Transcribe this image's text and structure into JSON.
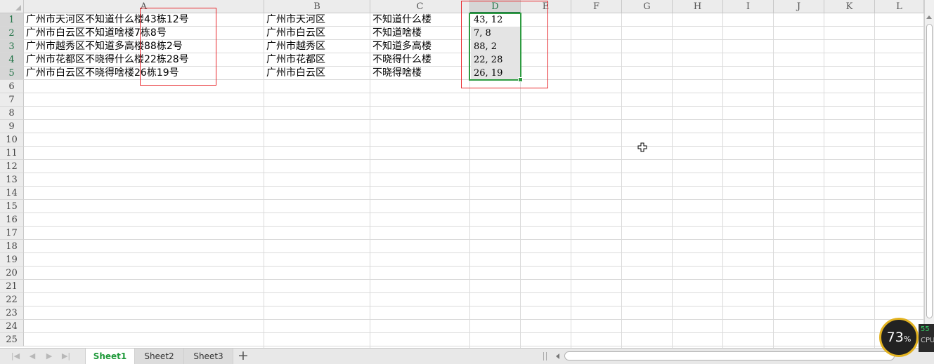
{
  "columns": [
    "A",
    "B",
    "C",
    "D",
    "E",
    "F",
    "G",
    "H",
    "I",
    "J",
    "K",
    "L"
  ],
  "rows": [
    "1",
    "2",
    "3",
    "4",
    "5",
    "6",
    "7",
    "8",
    "9",
    "10",
    "11",
    "12",
    "13",
    "14",
    "15",
    "16",
    "17",
    "18",
    "19",
    "20",
    "21",
    "22",
    "23",
    "24",
    "25"
  ],
  "cells": {
    "A": [
      "广州市天河区不知道什么楼43栋12号",
      "广州市白云区不知道啥楼7栋8号",
      "广州市越秀区不知道多高楼88栋2号",
      "广州市花都区不晓得什么楼22栋28号",
      "广州市白云区不晓得啥楼26栋19号"
    ],
    "B": [
      "广州市天河区",
      "广州市白云区",
      "广州市越秀区",
      "广州市花都区",
      "广州市白云区"
    ],
    "C": [
      "不知道什么楼",
      "不知道啥楼",
      "不知道多高楼",
      "不晓得什么楼",
      "不晓得啥楼"
    ],
    "D": [
      "43, 12",
      "7, 8",
      "88, 2",
      "22, 28",
      "26, 19"
    ]
  },
  "selection": {
    "column": "D",
    "rows": "1-5",
    "active_cell": "D1"
  },
  "sheet_tabs": [
    {
      "label": "Sheet1",
      "active": true
    },
    {
      "label": "Sheet2",
      "active": false
    },
    {
      "label": "Sheet3",
      "active": false
    }
  ],
  "add_sheet_label": "+",
  "status": {
    "cpu_percent": "73",
    "percent_sign": "%",
    "side_value": "55",
    "side_label": "CPU"
  },
  "colors": {
    "selection": "#2e9b41",
    "annotation_box": "#e8262b",
    "active_tab_text": "#1f9a3a",
    "cpu_ring": "#e3b321"
  }
}
